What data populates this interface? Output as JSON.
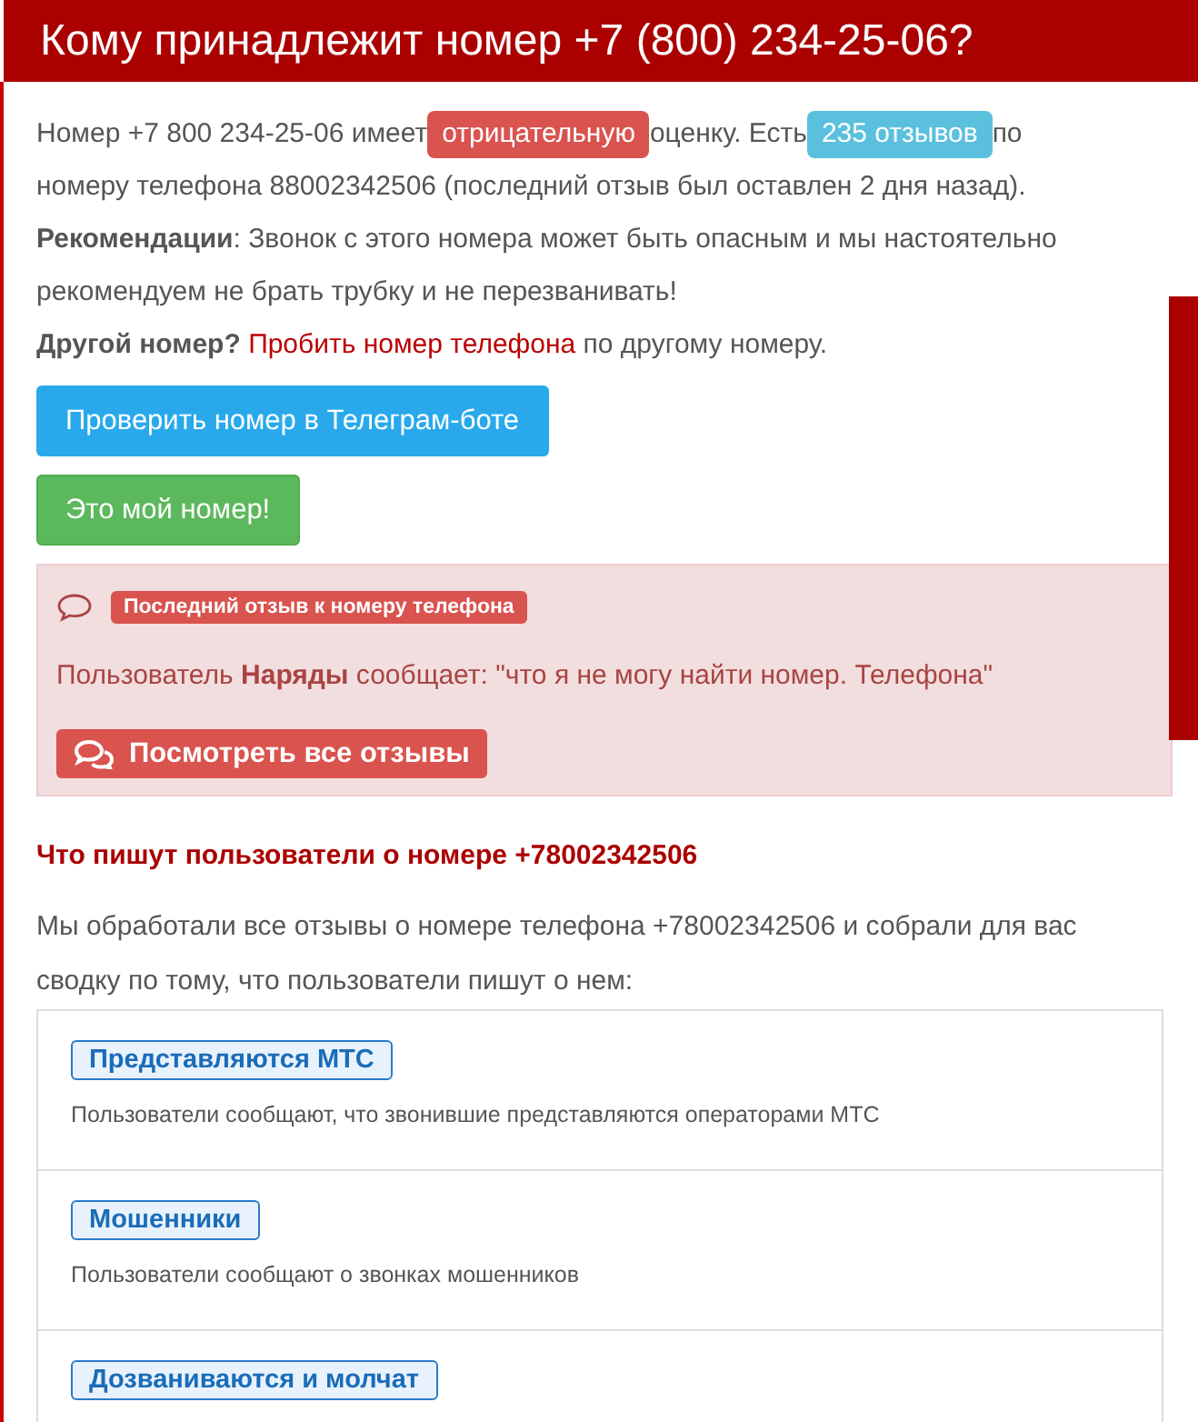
{
  "title": "Кому принадлежит номер +7 (800) 234-25-06?",
  "intro": {
    "before": "Номер +7 800 234-25-06 имеет",
    "rating": "отрицательную",
    "middle": "оценку. Есть",
    "count": "235 отзывов",
    "after": "по",
    "continuation": "номеру телефона 88002342506 (последний отзыв был оставлен 2 дня назад)."
  },
  "recommendation": "**Рекомендации**: Звонок с этого номера может быть опасным и мы настоятельно рекомендуем не брать трубку и не перезванивать!",
  "other": {
    "question": "Другой номер?",
    "link": "Пробить номер телефона",
    "after": "по другому номеру."
  },
  "buttons": [
    {
      "label": "Проверить номер в Телеграм-боте",
      "kind": "primary"
    },
    {
      "label": "Это мой номер!",
      "kind": "success"
    }
  ],
  "last_review": {
    "badge": "Последний отзыв к номеру телефона",
    "text": "Пользователь **Наряды** сообщает: \"что я не могу найти номер. Телефона\"",
    "button": "Посмотреть все отзывы"
  },
  "summary": {
    "heading": "Что пишут пользователи о номере +78002342506",
    "intro": "Мы обработали все отзывы о номере телефона +78002342506 и собрали для вас сводку по тому, что пользователи пишут о нем:",
    "items": [
      {
        "tag": "Представляются МТС",
        "text": "Пользователи сообщают, что звонившие представляются операторами МТС"
      },
      {
        "tag": "Мошенники",
        "text": "Пользователи сообщают о звонках мошенников"
      },
      {
        "tag": "Дозваниваются и молчат"
      }
    ]
  }
}
